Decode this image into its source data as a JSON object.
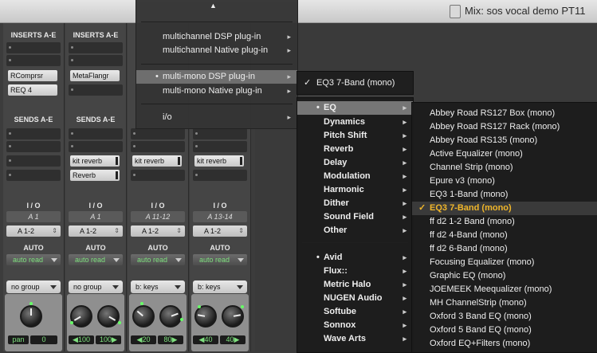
{
  "window": {
    "title": "Mix: sos vocal demo PT11"
  },
  "mixer": {
    "inserts_header": "INSERTS A-E",
    "sends_header": "SENDS A-E",
    "io_header": "I / O",
    "auto_header": "AUTO",
    "strips": [
      {
        "inserts": [
          "RComprsr",
          "REQ 4"
        ],
        "sends": [],
        "io_in": "A 1",
        "io_out": "A 1-2",
        "auto": "auto read",
        "group": "no group",
        "pan_label": "pan",
        "pan_values": [
          "0"
        ]
      },
      {
        "inserts": [
          "MetaFlangr"
        ],
        "sends": [
          "kit reverb",
          "Reverb"
        ],
        "io_in": "A 1",
        "io_out": "A 1-2",
        "auto": "auto read",
        "group": "no group",
        "pan_values": [
          "◀100",
          "100▶"
        ]
      },
      {
        "inserts": [],
        "sends": [
          "kit reverb"
        ],
        "io_in": "A 11-12",
        "io_out": "A 1-2",
        "auto": "auto read",
        "group": "b: keys",
        "pan_values": [
          "◀20",
          "80▶"
        ]
      },
      {
        "inserts": [],
        "sends": [
          "kit reverb"
        ],
        "io_in": "A 13-14",
        "io_out": "A 1-2",
        "auto": "auto read",
        "group": "b: keys",
        "pan_values": [
          "◀40",
          "40▶"
        ]
      }
    ]
  },
  "menu_main": {
    "scroll_up": "▲",
    "items": [
      "multichannel DSP plug-in",
      "multichannel Native plug-in",
      "multi-mono DSP plug-in",
      "multi-mono Native plug-in",
      "i/o"
    ]
  },
  "menu_sub": {
    "item": "EQ3 7-Band (mono)",
    "check": "✓"
  },
  "menu_categories": {
    "group1": [
      "EQ",
      "Dynamics",
      "Pitch Shift",
      "Reverb",
      "Delay",
      "Modulation",
      "Harmonic",
      "Dither",
      "Sound Field",
      "Other"
    ],
    "group2": [
      "Avid",
      "Flux::",
      "Metric Halo",
      "NUGEN Audio",
      "Softube",
      "Sonnox",
      "Wave Arts"
    ]
  },
  "menu_plugins": {
    "items": [
      "Abbey Road RS127 Box (mono)",
      "Abbey Road RS127 Rack (mono)",
      "Abbey Road RS135 (mono)",
      "Active Equalizer (mono)",
      "Channel Strip (mono)",
      "Epure v3 (mono)",
      "EQ3 1-Band (mono)",
      "EQ3 7-Band (mono)",
      "ff d2 1-2 Band (mono)",
      "ff d2 4-Band (mono)",
      "ff d2 6-Band (mono)",
      "Focusing Equalizer (mono)",
      "Graphic EQ (mono)",
      "JOEMEEK Meequalizer (mono)",
      "MH ChannelStrip (mono)",
      "Oxford 3 Band EQ (mono)",
      "Oxford 5 Band EQ (mono)",
      "Oxford EQ+Filters (mono)"
    ],
    "selected": "EQ3 7-Band (mono)"
  },
  "colors": {
    "selected_text": "#f0b62a",
    "meter_green": "#7ee07e"
  }
}
